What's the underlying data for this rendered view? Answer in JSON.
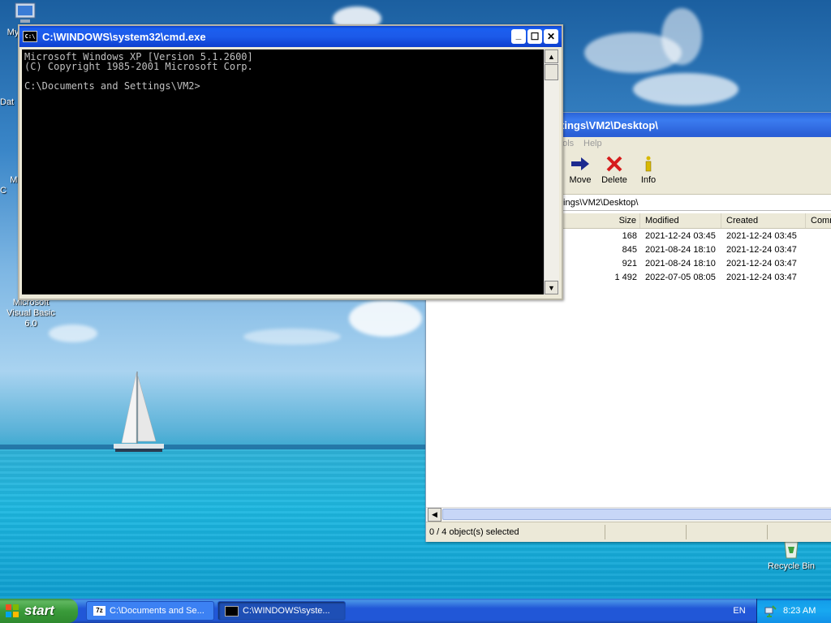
{
  "desktop": {
    "icons": [
      {
        "label": "My"
      },
      {
        "label": "Dat"
      },
      {
        "label": "Micro\nC"
      },
      {
        "label": "Microsoft Visual Basic 6.0"
      },
      {
        "label": "Recycle Bin"
      }
    ]
  },
  "cmd": {
    "title": "C:\\WINDOWS\\system32\\cmd.exe",
    "icon_text": "C:\\",
    "lines": [
      "Microsoft Windows XP [Version 5.1.2600]",
      "(C) Copyright 1985-2001 Microsoft Corp.",
      "",
      "C:\\Documents and Settings\\VM2>"
    ]
  },
  "file_manager": {
    "title": "tings\\VM2\\Desktop\\",
    "menu": [
      "ools",
      "Help"
    ],
    "toolbar": [
      {
        "label": "Move",
        "icon": "move-arrow-icon"
      },
      {
        "label": "Delete",
        "icon": "delete-x-icon"
      },
      {
        "label": "Info",
        "icon": "info-icon"
      }
    ],
    "address": "tings\\VM2\\Desktop\\",
    "columns": [
      "Size",
      "Modified",
      "Created",
      "Comm"
    ],
    "rows": [
      {
        "size": "168",
        "modified": "2021-12-24 03:45",
        "created": "2021-12-24 03:45"
      },
      {
        "size": "845",
        "modified": "2021-08-24 18:10",
        "created": "2021-12-24 03:47"
      },
      {
        "size": "921",
        "modified": "2021-08-24 18:10",
        "created": "2021-12-24 03:47"
      },
      {
        "size": "1 492",
        "modified": "2022-07-05 08:05",
        "created": "2021-12-24 03:47"
      }
    ],
    "status": "0 / 4 object(s) selected"
  },
  "taskbar": {
    "start_label": "start",
    "tasks": [
      {
        "label": "C:\\Documents and Se...",
        "icon": "7z"
      },
      {
        "label": "C:\\WINDOWS\\syste...",
        "icon": "cmd"
      }
    ],
    "language": "EN",
    "clock": "8:23 AM"
  }
}
